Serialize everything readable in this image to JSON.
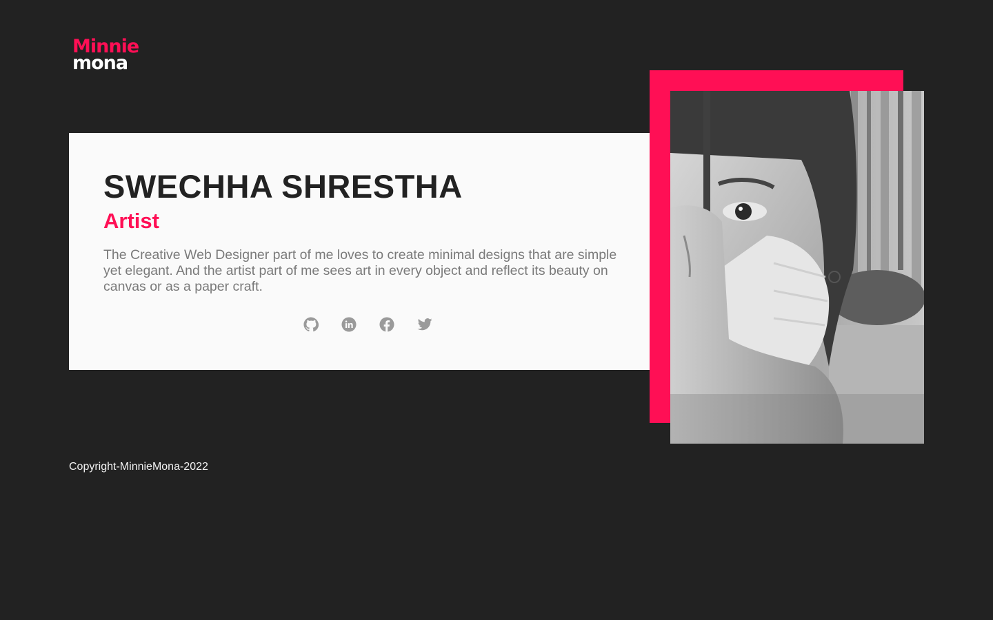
{
  "brand": {
    "logo_line1": "Minnie",
    "logo_line2": "mona",
    "accent_color": "#ff0f55"
  },
  "profile": {
    "name": "SWECHHA SHRESTHA",
    "role": "Artist",
    "bio": "The Creative Web Designer part of me loves to create minimal designs that are simple yet elegant. And the artist part of me sees art in every object and reflect its beauty on canvas or as a paper craft.",
    "photo_icon": "portrait-photo"
  },
  "socials": [
    {
      "icon": "github-icon"
    },
    {
      "icon": "linkedin-icon"
    },
    {
      "icon": "facebook-icon"
    },
    {
      "icon": "twitter-icon"
    }
  ],
  "footer": {
    "copyright": "Copyright-MinnieMona-2022"
  },
  "colors": {
    "background": "#222222",
    "card": "#fafafa",
    "text_dark": "#222222",
    "text_muted": "#7a7a7a",
    "icon_gray": "#9a9a9a"
  }
}
